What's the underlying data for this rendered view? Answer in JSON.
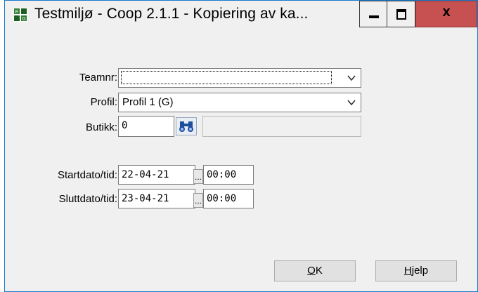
{
  "window": {
    "title": "Testmiljø - Coop 2.1.1  -  Kopiering av ka...",
    "minimize_icon": "minimize-icon",
    "maximize_icon": "maximize-icon",
    "close_label": "x"
  },
  "form": {
    "teamnr": {
      "label": "Teamnr:",
      "value": ""
    },
    "profil": {
      "label": "Profil:",
      "value": "Profil 1 (G)"
    },
    "butikk": {
      "label": "Butikk:",
      "value": "0",
      "search_icon": "binoculars-icon",
      "name_value": ""
    },
    "startdato": {
      "label": "Startdato/tid:",
      "date": "22-04-21",
      "picker": "...",
      "time": "00:00"
    },
    "sluttdato": {
      "label": "Sluttdato/tid:",
      "date": "23-04-21",
      "picker": "...",
      "time": "00:00"
    }
  },
  "buttons": {
    "ok_mnemonic": "O",
    "ok_rest": "K",
    "help_mnemonic": "H",
    "help_rest": "jelp"
  },
  "colors": {
    "close_button": "#c75050",
    "window_border": "#1979ca"
  }
}
